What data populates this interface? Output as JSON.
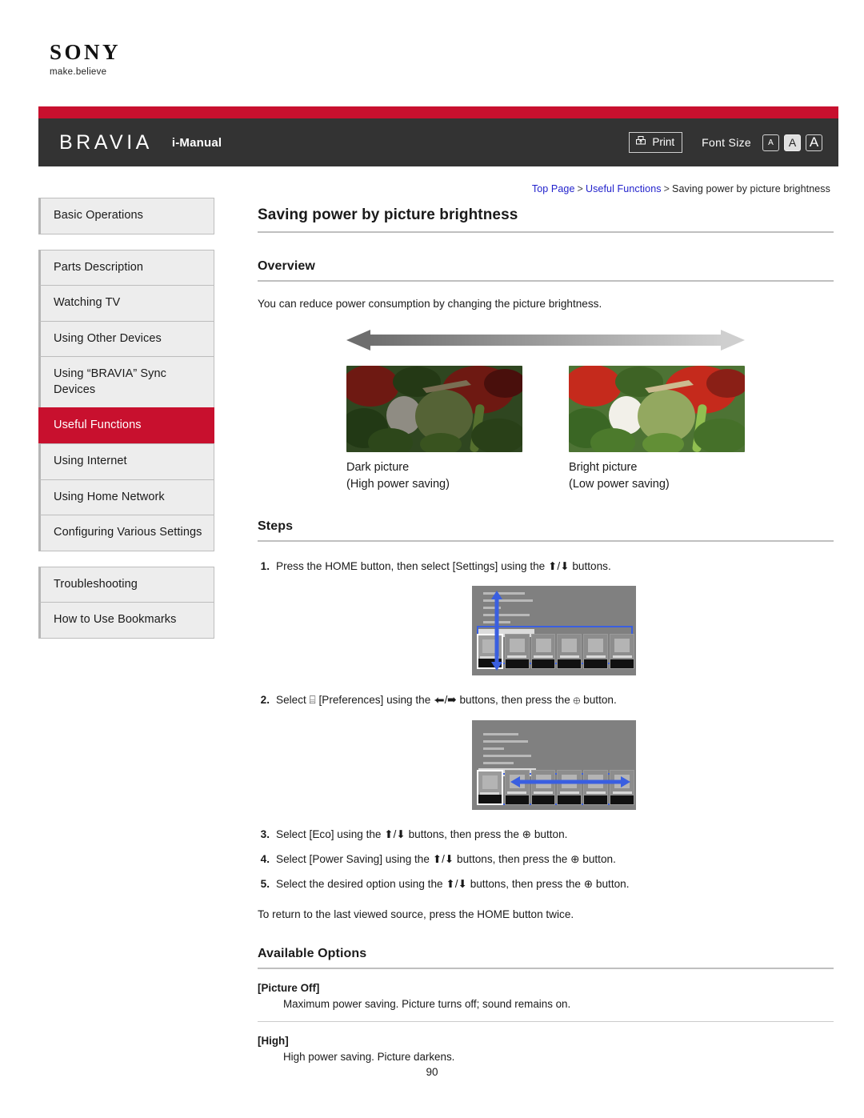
{
  "brand": {
    "logo_text": "SONY",
    "tagline": "make.believe",
    "product_logo": "BRAVIA",
    "manual_label": "i-Manual"
  },
  "toolbar": {
    "print_label": "Print",
    "print_icon": "printer-icon",
    "font_size_label": "Font Size",
    "font_sizes": [
      {
        "label": "A",
        "selected": false
      },
      {
        "label": "A",
        "selected": true
      },
      {
        "label": "A",
        "selected": false
      }
    ]
  },
  "breadcrumb": {
    "items": [
      "Top Page",
      "Useful Functions",
      "Saving power by picture brightness"
    ],
    "separator": ">"
  },
  "sidebar": {
    "groups": [
      {
        "items": [
          {
            "label": "Basic Operations",
            "active": false
          }
        ]
      },
      {
        "items": [
          {
            "label": "Parts Description",
            "active": false
          },
          {
            "label": "Watching TV",
            "active": false
          },
          {
            "label": "Using Other Devices",
            "active": false
          },
          {
            "label": "Using “BRAVIA” Sync Devices",
            "active": false
          },
          {
            "label": "Useful Functions",
            "active": true
          },
          {
            "label": "Using Internet",
            "active": false
          },
          {
            "label": "Using Home Network",
            "active": false
          },
          {
            "label": "Configuring Various Settings",
            "active": false
          }
        ]
      },
      {
        "items": [
          {
            "label": "Troubleshooting",
            "active": false
          },
          {
            "label": "How to Use Bookmarks",
            "active": false
          }
        ]
      }
    ]
  },
  "main": {
    "title": "Saving power by picture brightness",
    "overview_heading": "Overview",
    "overview_text": "You can reduce power consumption by changing the picture brightness.",
    "figure": {
      "left_caption_line1": "Dark picture",
      "left_caption_line2": "(High power saving)",
      "right_caption_line1": "Bright picture",
      "right_caption_line2": "(Low power saving)"
    },
    "steps_heading": "Steps",
    "steps": [
      {
        "num": "1.",
        "text": "Press the HOME button, then select [Settings] using the ⬆/⬇ buttons."
      },
      {
        "num": "2.",
        "text": "Select ⌸ [Preferences] using the ⬅/➡ buttons, then press the ⊕ button."
      },
      {
        "num": "3.",
        "text": "Select [Eco] using the ⬆/⬇ buttons, then press the ⊕ button."
      },
      {
        "num": "4.",
        "text": "Select [Power Saving] using the ⬆/⬇ buttons, then press the ⊕ button."
      },
      {
        "num": "5.",
        "text": "Select the desired option using the ⬆/⬇ buttons, then press the ⊕ button."
      }
    ],
    "note": "To return to the last viewed source, press the HOME button twice.",
    "options_heading": "Available Options",
    "options": [
      {
        "name": "[Picture Off]",
        "desc": "Maximum power saving. Picture turns off; sound remains on."
      },
      {
        "name": "[High]",
        "desc": "High power saving. Picture darkens."
      }
    ],
    "page_number": "90"
  },
  "colors": {
    "accent_red": "#c8102e",
    "header_dark": "#333333",
    "link_blue": "#2222cc",
    "nav_bg": "#ededed"
  }
}
